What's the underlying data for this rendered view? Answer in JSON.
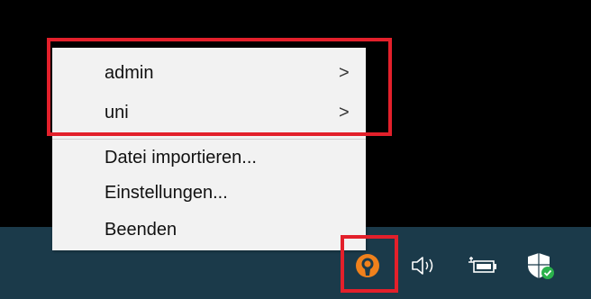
{
  "context_menu": {
    "items": [
      {
        "label": "admin",
        "submenu_indicator": ">"
      },
      {
        "label": "uni",
        "submenu_indicator": ">"
      },
      {
        "label": "Datei importieren..."
      },
      {
        "label": "Einstellungen..."
      },
      {
        "label": "Beenden"
      }
    ]
  },
  "tray": {
    "icons": [
      "openvpn-icon",
      "speaker-icon",
      "battery-icon",
      "windows-security-icon"
    ]
  },
  "colors": {
    "desktop_background": "#000000",
    "taskbar_background": "#1b3a4a",
    "menu_background": "#f2f2f2",
    "highlight": "#e3202b",
    "openvpn_orange": "#f0811c",
    "security_check_green": "#2bb24c"
  }
}
